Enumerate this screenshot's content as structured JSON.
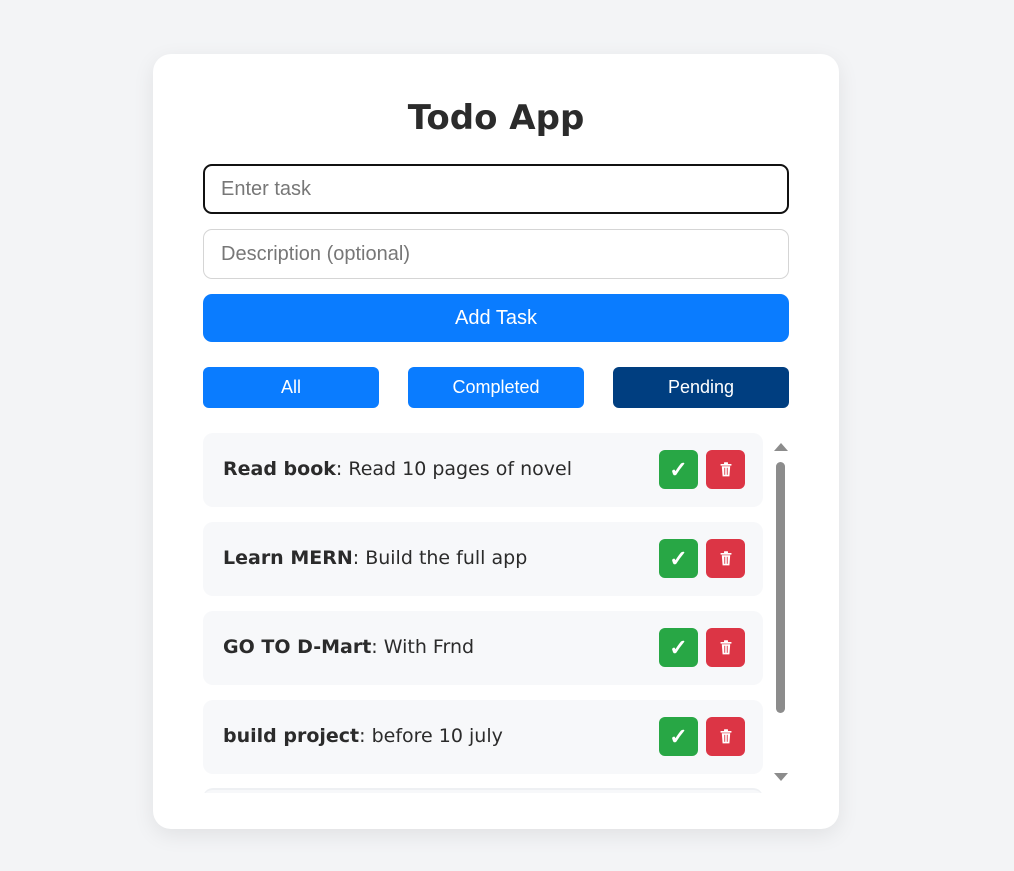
{
  "app": {
    "title": "Todo App"
  },
  "form": {
    "task_placeholder": "Enter task",
    "task_value": "",
    "description_placeholder": "Description (optional)",
    "description_value": "",
    "add_label": "Add Task"
  },
  "filters": {
    "all": "All",
    "completed": "Completed",
    "pending": "Pending",
    "active": "Pending"
  },
  "todos": [
    {
      "title": "Read book",
      "sep": ": ",
      "description": "Read 10 pages of novel"
    },
    {
      "title": "Learn MERN",
      "sep": ": ",
      "description": "Build the full app"
    },
    {
      "title": "GO TO D-Mart",
      "sep": ": ",
      "description": "With Frnd"
    },
    {
      "title": "build project",
      "sep": ": ",
      "description": "before 10 july"
    }
  ],
  "icons": {
    "complete": "check-icon",
    "delete": "trash-icon"
  },
  "colors": {
    "primary": "#0a7cff",
    "active_filter": "#003e80",
    "complete": "#28a745",
    "delete": "#dc3545"
  }
}
